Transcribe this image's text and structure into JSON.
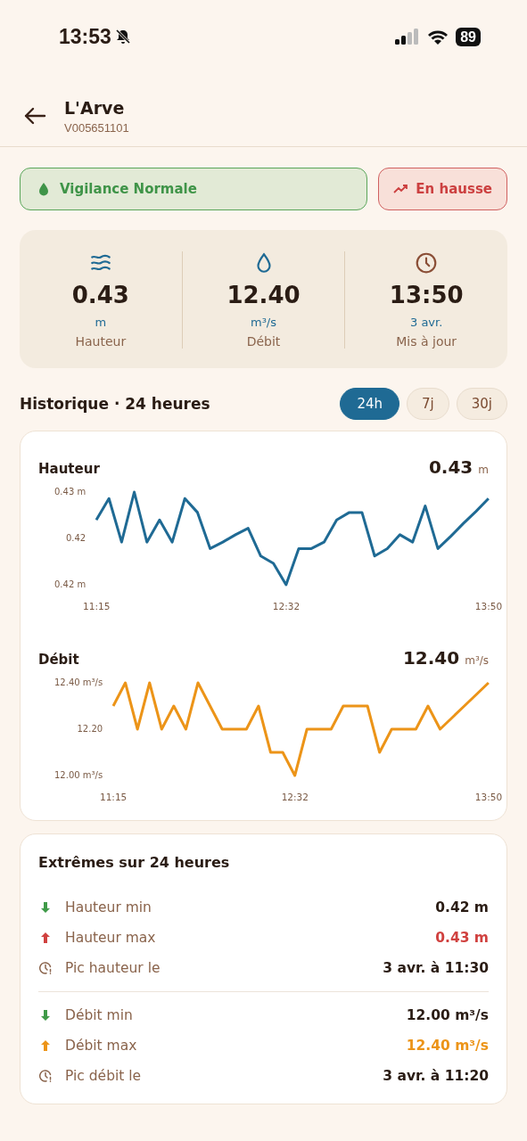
{
  "status_bar": {
    "time": "13:53",
    "battery": "89"
  },
  "header": {
    "title": "L'Arve",
    "subtitle": "V005651101"
  },
  "badges": [
    {
      "kind": "vigilance",
      "label": "Vigilance Normale"
    },
    {
      "kind": "trend",
      "label": "En hausse"
    }
  ],
  "stats": [
    {
      "kind": "height",
      "value": "0.43",
      "unit": "m",
      "label": "Hauteur"
    },
    {
      "kind": "flow",
      "value": "12.40",
      "unit": "m³/s",
      "label": "Débit"
    },
    {
      "kind": "updated",
      "value": "13:50",
      "unit": "3 avr.",
      "label": "Mis à jour"
    }
  ],
  "history": {
    "title": "Historique · 24 heures",
    "periods": [
      {
        "label": "24h",
        "selected": true
      },
      {
        "label": "7j",
        "selected": false
      },
      {
        "label": "30j",
        "selected": false
      }
    ]
  },
  "charts": [
    {
      "title": "Hauteur",
      "current": "0.43",
      "unit": "m",
      "chart_data": {
        "type": "line",
        "categories": [
          "11:15",
          null,
          null,
          null,
          null,
          null,
          null,
          null,
          null,
          null,
          null,
          null,
          null,
          null,
          null,
          "12:32",
          null,
          null,
          null,
          null,
          null,
          null,
          null,
          null,
          null,
          null,
          null,
          null,
          null,
          null,
          null,
          "13:50"
        ],
        "ylim": [
          0.42,
          0.43
        ],
        "yticks": [
          {
            "value": 0.43,
            "label": "0.43 m"
          },
          {
            "value": 0.425,
            "label": "0.42"
          },
          {
            "value": 0.42,
            "label": "0.42 m"
          }
        ],
        "series": [
          {
            "color": "#1f6a94",
            "values": [
              0.427,
              0.4293,
              0.4246,
              0.43,
              0.4246,
              0.427,
              0.4246,
              0.4293,
              0.4278,
              0.4239,
              0.4246,
              0.4254,
              0.4261,
              0.4231,
              0.4223,
              0.42,
              0.4239,
              0.4239,
              0.4246,
              0.427,
              0.4278,
              0.4278,
              0.4231,
              0.4239,
              0.4254,
              0.4246,
              0.4285,
              0.4239,
              0.4252,
              0.4266,
              0.4279,
              0.4293
            ]
          }
        ]
      }
    },
    {
      "title": "Débit",
      "current": "12.40",
      "unit": "m³/s",
      "chart_data": {
        "type": "line",
        "categories": [
          "11:15",
          null,
          null,
          null,
          null,
          null,
          null,
          null,
          null,
          null,
          null,
          null,
          null,
          null,
          null,
          "12:32",
          null,
          null,
          null,
          null,
          null,
          null,
          null,
          null,
          null,
          null,
          null,
          null,
          null,
          null,
          null,
          "13:50"
        ],
        "ylim": [
          12.0,
          12.4
        ],
        "yticks": [
          {
            "value": 12.4,
            "label": "12.40 m³/s"
          },
          {
            "value": 12.2,
            "label": "12.20"
          },
          {
            "value": 12.0,
            "label": "12.00 m³/s"
          }
        ],
        "series": [
          {
            "color": "#ec9418",
            "values": [
              12.3,
              12.4,
              12.2,
              12.4,
              12.2,
              12.3,
              12.2,
              12.4,
              12.3,
              12.2,
              12.2,
              12.2,
              12.3,
              12.1,
              12.1,
              12.0,
              12.2,
              12.2,
              12.2,
              12.3,
              12.3,
              12.3,
              12.1,
              12.2,
              12.2,
              12.2,
              12.3,
              12.2,
              12.25,
              12.3,
              12.35,
              12.4
            ]
          }
        ]
      }
    }
  ],
  "extremes": {
    "title": "Extrêmes sur 24 heures",
    "groups": [
      [
        {
          "kind": "min",
          "label": "Hauteur min",
          "value": "0.42 m",
          "color": "#2a1c14"
        },
        {
          "kind": "max",
          "label": "Hauteur max",
          "value": "0.43 m",
          "color": "#d0413f"
        },
        {
          "kind": "peak",
          "label": "Pic hauteur le",
          "value": "3 avr. à 11:30",
          "color": "#2a1c14"
        }
      ],
      [
        {
          "kind": "min",
          "label": "Débit min",
          "value": "12.00 m³/s",
          "color": "#2a1c14"
        },
        {
          "kind": "max",
          "label": "Débit max",
          "value": "12.40 m³/s",
          "color": "#ec9418"
        },
        {
          "kind": "peak",
          "label": "Pic débit le",
          "value": "3 avr. à 11:20",
          "color": "#2a1c14"
        }
      ]
    ]
  }
}
